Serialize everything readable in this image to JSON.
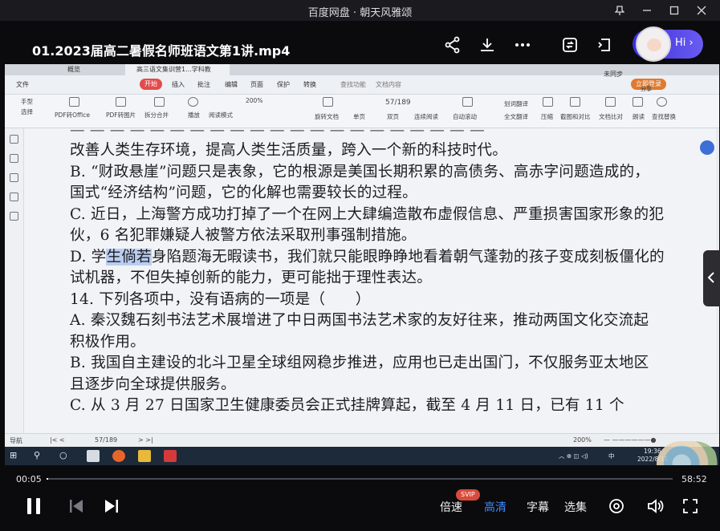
{
  "window": {
    "title": "百度网盘 · 朝天风雅颂"
  },
  "player": {
    "video_title": "01.2023届高二暑假名师班语文第1讲.mp4",
    "hi_label": "Hi",
    "current_time": "00:05",
    "total_time": "58:52",
    "progress_fraction": 0.0014,
    "speed_label": "倍速",
    "svip_badge": "SVIP",
    "quality_label": "高清",
    "subtitle_label": "字幕",
    "episode_label": "选集"
  },
  "wps": {
    "tabs": [
      "概览",
      "高三语文集训营1...学科教材.pdf"
    ],
    "menu": {
      "file": "文件",
      "start": "开始",
      "insert": "插入",
      "annotate": "批注",
      "edit": "编辑",
      "page": "页面",
      "protect": "保护",
      "convert": "转换",
      "search_feature": "查找功能",
      "doc_content": "文档内容",
      "login": "立即登录",
      "unsync": "未同步",
      "share": "分享"
    },
    "toolbar": {
      "hand": "手型",
      "select": "选择",
      "pdf_to_office": "PDF转Office",
      "pdf_to_image": "PDF转图片",
      "split_merge": "拆分合并",
      "zoom": "200%",
      "play": "播放",
      "read_mode": "阅读模式",
      "rotate": "旋转文档",
      "page_indicator": "57/189",
      "single_page": "单页",
      "double_page": "双页",
      "continuous": "连续阅读",
      "auto_scroll": "自动滚动",
      "translate": "划词翻译",
      "full_translate": "全文翻译",
      "compress": "压缩",
      "screenshot_compare": "截图和对比",
      "doc_compare": "文档比对",
      "read_aloud": "朗读",
      "find_replace": "查找替换"
    },
    "document_lines": [
      "改善人类生存环境，提高人类生活质量，跨入一个新的科技时代。",
      "B. “财政悬崖”问题只是表象，它的根源是美国长期积累的高债务、高赤字问题造成的，",
      "国式“经济结构”问题，它的化解也需要较长的过程。",
      "C. 近日，上海警方成功打掉了一个在网上大肆编造散布虚假信息、严重损害国家形象的犯",
      "伙，6 名犯罪嫌疑人被警方依法采取刑事强制措施。",
      "D. 学生倘若身陷题海无暇读书，我们就只能眼睁睁地看着朝气蓬勃的孩子变成刻板僵化的",
      "试机器，不但失掉创新的能力，更可能拙于理性表达。",
      "14. 下列各项中，没有语病的一项是（　　）",
      "A. 秦汉魏石刻书法艺术展增进了中日两国书法艺术家的友好往来，推动两国文化交流起",
      "积极作用。",
      "B. 我国自主建设的北斗卫星全球组网稳步推进，应用也已走出国门，不仅服务亚太地区",
      "且逐步向全球提供服务。",
      "C. 从 3 月 27 日国家卫生健康委员会正式挂牌算起，截至 4 月 11 日，已有 11 个"
    ],
    "highlight_prefix": "D. 学",
    "highlight_text": "生倘若",
    "highlight_suffix": "身陷题海无暇读书，我们就只能眼睁睁地看着朝气蓬勃的孩子变成刻板僵化的",
    "status": {
      "nav": "导航",
      "page": "57/189",
      "zoom": "200%"
    }
  },
  "taskbar": {
    "time": "19:36",
    "date": "2022/8/11",
    "ime": "中"
  }
}
